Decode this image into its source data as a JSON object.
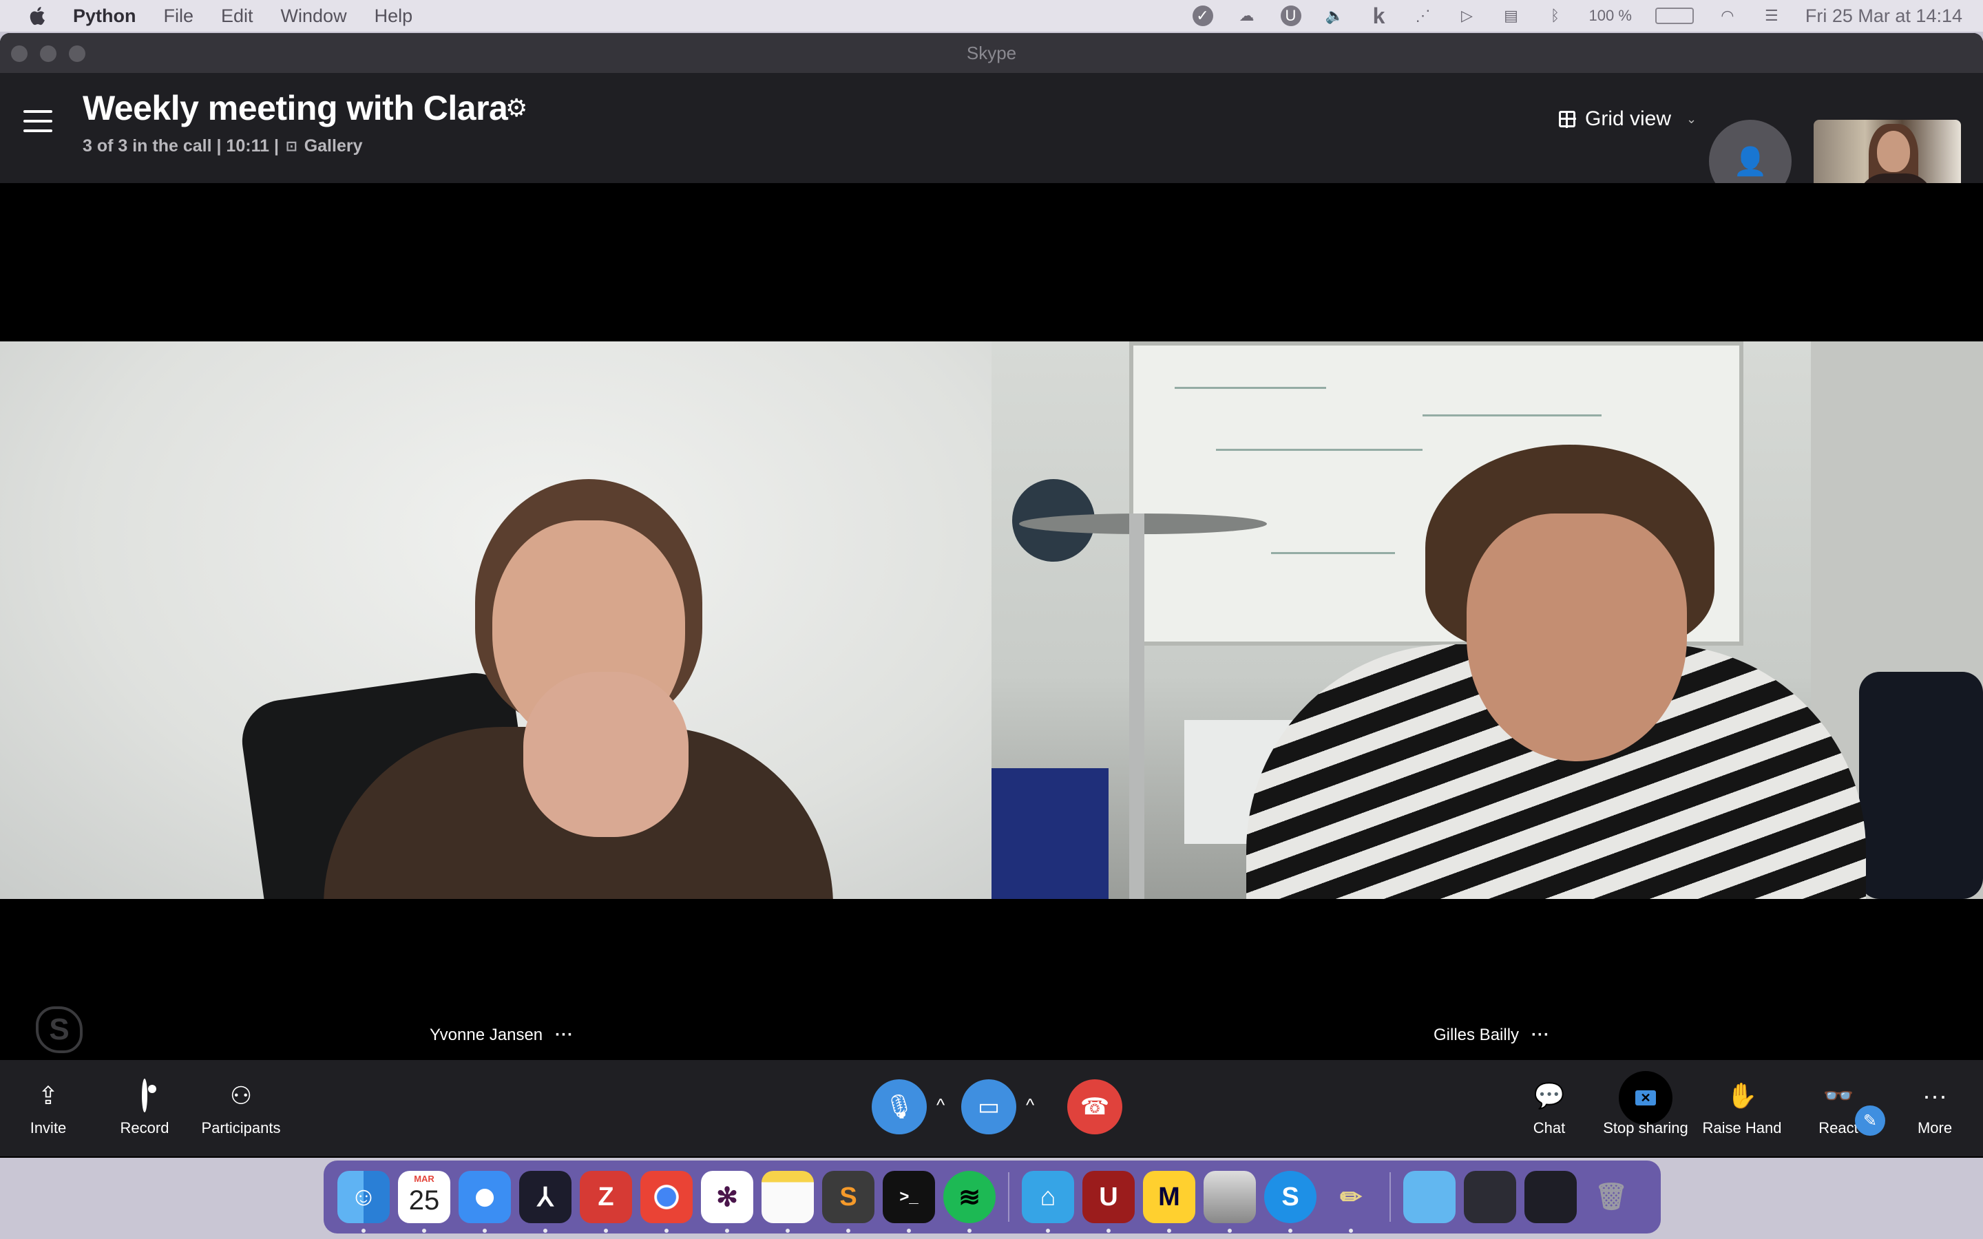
{
  "menubar": {
    "app_name": "Python",
    "items": [
      "File",
      "Edit",
      "Window",
      "Help"
    ],
    "battery": "100 %",
    "clock": "Fri 25 Mar at  14:14"
  },
  "window": {
    "title": "Skype"
  },
  "call": {
    "title": "Weekly meeting with Clara",
    "participants_status": "3 of 3 in the call | 10:11 |",
    "layout_label": "Gallery",
    "view_mode": "Grid view"
  },
  "participants": [
    {
      "name": "Yvonne Jansen",
      "more": "···"
    },
    {
      "name": "Gilles Bailly",
      "more": "···"
    }
  ],
  "controls": {
    "invite": "Invite",
    "record": "Record",
    "participants": "Participants",
    "chat": "Chat",
    "stop_sharing": "Stop sharing",
    "raise_hand": "Raise Hand",
    "react": "React",
    "more": "More"
  },
  "dock": {
    "calendar_month": "MAR",
    "calendar_day": "25",
    "apps": [
      "Finder",
      "Calendar",
      "Safari",
      "Acrobat",
      "Zotero",
      "Chrome",
      "Slack",
      "Notes",
      "Sublime Text",
      "Terminal",
      "Spotify",
      "Home",
      "Ublock",
      "Miro",
      "Database",
      "Skype",
      "Pencil",
      "Folder",
      "Window 1",
      "Window 2",
      "Trash"
    ]
  },
  "colors": {
    "accent_blue": "#3f8fe0",
    "hangup_red": "#e0423c",
    "header_bg": "#1f1f23"
  }
}
